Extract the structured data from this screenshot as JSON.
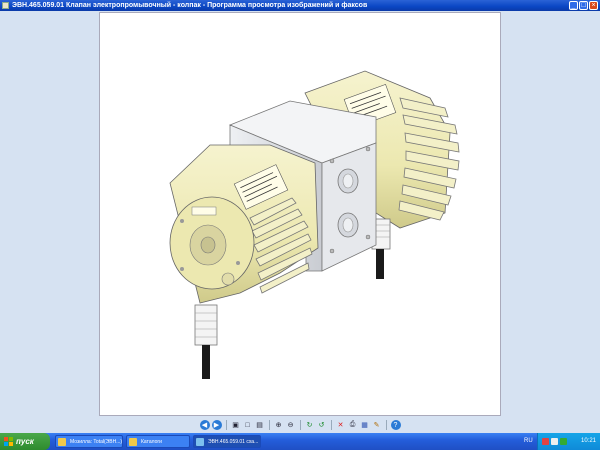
{
  "window": {
    "title": "ЭВН.465.059.01 Клапан электропромывочный - колпак - Программа просмотра изображений и факсов",
    "icon": "image-viewer-icon",
    "buttons": [
      "minimize-icon",
      "maximize-icon",
      "close-icon"
    ]
  },
  "viewer": {
    "image_subject": "pump-3d-render",
    "colors": {
      "body": "#f2efc0",
      "block": "#e2e4e8",
      "cable": "#1a1a1a"
    }
  },
  "toolbar": {
    "icons": [
      "previous-image-icon",
      "next-image-icon",
      "best-fit-icon",
      "actual-size-icon",
      "slideshow-icon",
      "zoom-in-icon",
      "zoom-out-icon",
      "rotate-clockwise-icon",
      "rotate-counterclockwise-icon",
      "delete-icon",
      "print-icon",
      "save-icon",
      "open-editor-icon",
      "help-icon"
    ]
  },
  "taskbar": {
    "start_label": "пуск",
    "tasks": [
      {
        "label": "Мозилла: Total(ЭВН...)",
        "icon": "folder-icon"
      },
      {
        "label": "Каталоги",
        "icon": "folder-icon"
      },
      {
        "label": "ЭВН.465.059.01 сха...",
        "icon": "image-icon",
        "active": true
      }
    ],
    "language": "RU",
    "clock": "10:21"
  }
}
